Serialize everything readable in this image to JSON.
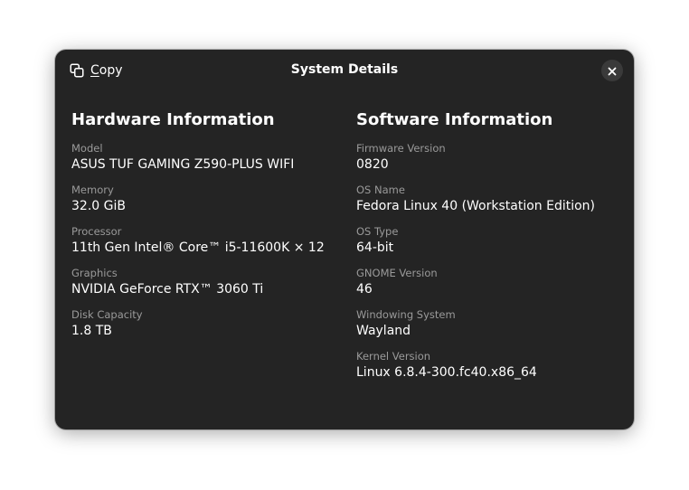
{
  "dialog": {
    "title": "System Details",
    "copy_label_mnemonic": "C",
    "copy_label_rest": "opy"
  },
  "hardware": {
    "title": "Hardware Information",
    "fields": [
      {
        "label": "Model",
        "value": "ASUS TUF GAMING Z590-PLUS WIFI"
      },
      {
        "label": "Memory",
        "value": "32.0 GiB"
      },
      {
        "label": "Processor",
        "value": "11th Gen Intel® Core™ i5-11600K × 12"
      },
      {
        "label": "Graphics",
        "value": "NVIDIA GeForce RTX™ 3060 Ti"
      },
      {
        "label": "Disk Capacity",
        "value": "1.8 TB"
      }
    ]
  },
  "software": {
    "title": "Software Information",
    "fields": [
      {
        "label": "Firmware Version",
        "value": "0820"
      },
      {
        "label": "OS Name",
        "value": "Fedora Linux 40 (Workstation Edition)"
      },
      {
        "label": "OS Type",
        "value": "64-bit"
      },
      {
        "label": "GNOME Version",
        "value": "46"
      },
      {
        "label": "Windowing System",
        "value": "Wayland"
      },
      {
        "label": "Kernel Version",
        "value": "Linux 6.8.4-300.fc40.x86_64"
      }
    ]
  },
  "icons": {
    "copy": "copy-icon",
    "close": "close-icon"
  },
  "colors": {
    "dialog_bg": "#242424",
    "label": "#9a9a9a",
    "text": "#ffffff",
    "close_bg": "#3a3a3a"
  }
}
